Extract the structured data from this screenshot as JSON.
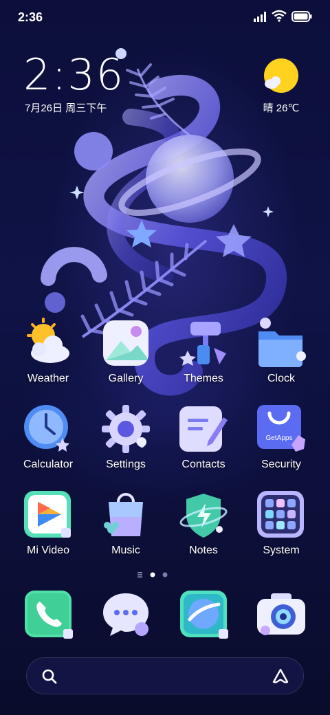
{
  "status_bar": {
    "time": "2:36"
  },
  "clock_widget": {
    "time": "2:36",
    "date": "7月26日 周三下午"
  },
  "weather_widget": {
    "condition_temp": "晴 26℃"
  },
  "apps_row1": [
    "Weather",
    "Gallery",
    "Themes",
    "Clock"
  ],
  "apps_row2": [
    "Calculator",
    "Settings",
    "Contacts",
    "Security"
  ],
  "apps_row3": [
    "Mi Video",
    "Music",
    "Notes",
    "System"
  ],
  "security_badge": "GetApps",
  "colors": {
    "accent": "#6a5cff",
    "background": "#0f1346",
    "sun": "#ffd21f"
  }
}
